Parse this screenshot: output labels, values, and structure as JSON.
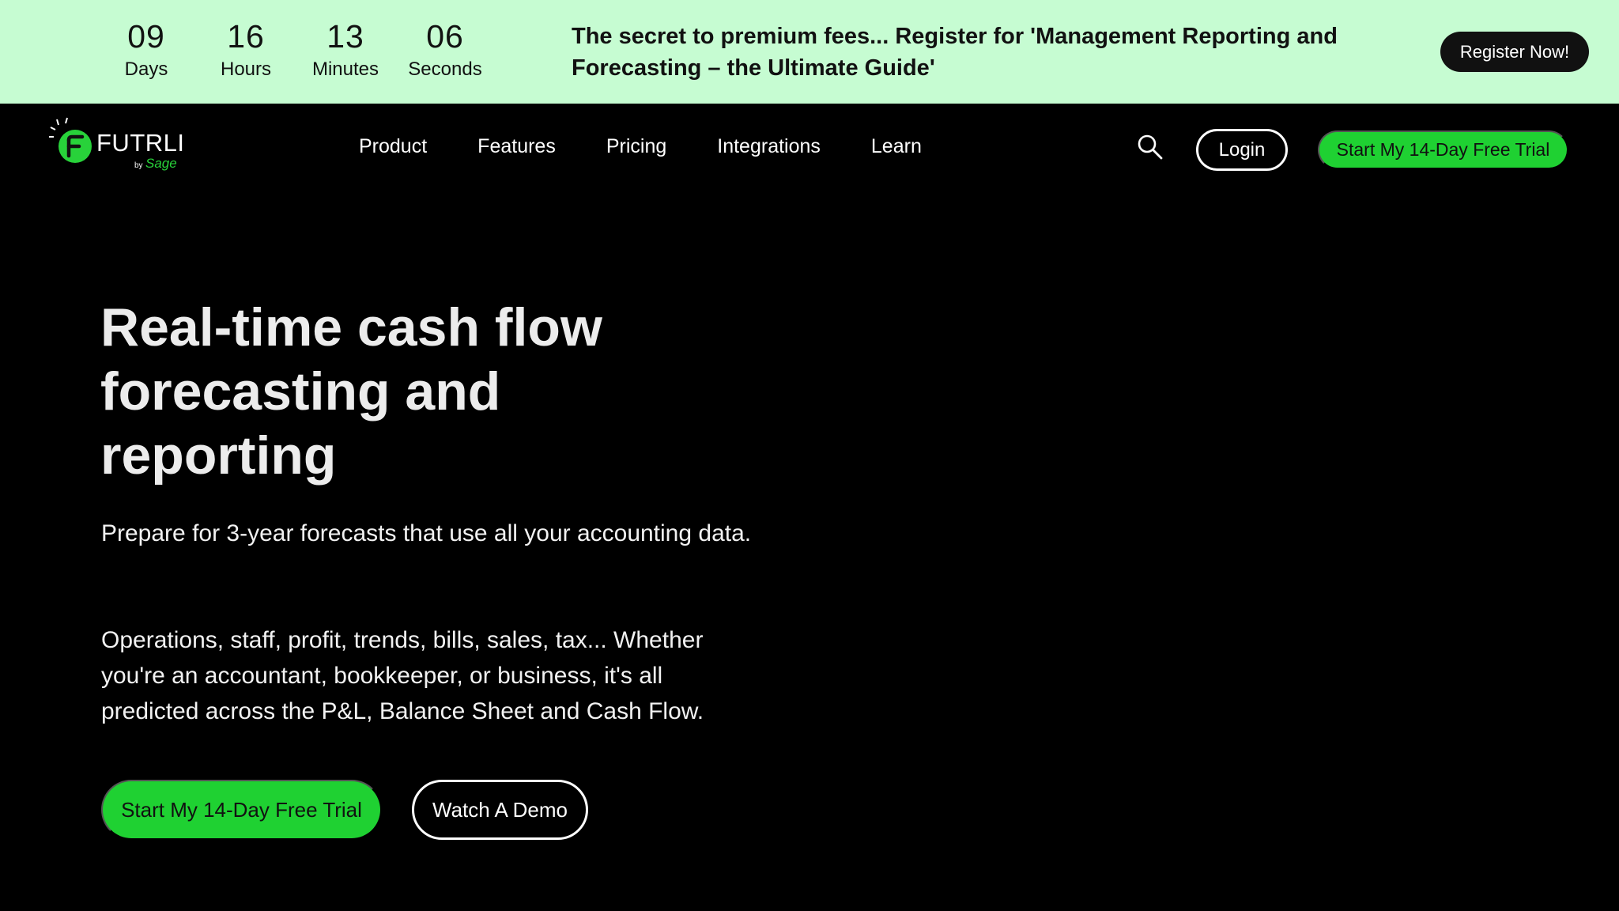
{
  "banner": {
    "countdown": [
      {
        "value": "09",
        "label": "Days"
      },
      {
        "value": "16",
        "label": "Hours"
      },
      {
        "value": "13",
        "label": "Minutes"
      },
      {
        "value": "06",
        "label": "Seconds"
      }
    ],
    "promo_text": "The secret to premium fees... Register for 'Management Reporting and Forecasting – the Ultimate Guide'",
    "register_label": "Register Now!",
    "background_color": "#c6fcd2"
  },
  "nav": {
    "logo": {
      "name": "FUTRLI",
      "by": "by",
      "partner": "Sage"
    },
    "menu": [
      "Product",
      "Features",
      "Pricing",
      "Integrations",
      "Learn"
    ],
    "login_label": "Login",
    "trial_label": "Start My 14-Day Free Trial",
    "icons": {
      "search": "search-icon",
      "logo": "futrli-logo-icon"
    }
  },
  "hero": {
    "title": "Real-time cash flow forecasting and reporting",
    "paragraph1": "Prepare for 3-year forecasts that use all your accounting data.",
    "paragraph2": "Operations, staff, profit, trends, bills, sales, tax... Whether you're an accountant, bookkeeper, or business, it's all predicted across the P&L, Balance Sheet and Cash Flow.",
    "cta_trial": "Start My 14-Day Free Trial",
    "cta_demo": "Watch A Demo"
  },
  "colors": {
    "accent": "#1fd132",
    "background": "#000000",
    "text": "#ffffff"
  }
}
